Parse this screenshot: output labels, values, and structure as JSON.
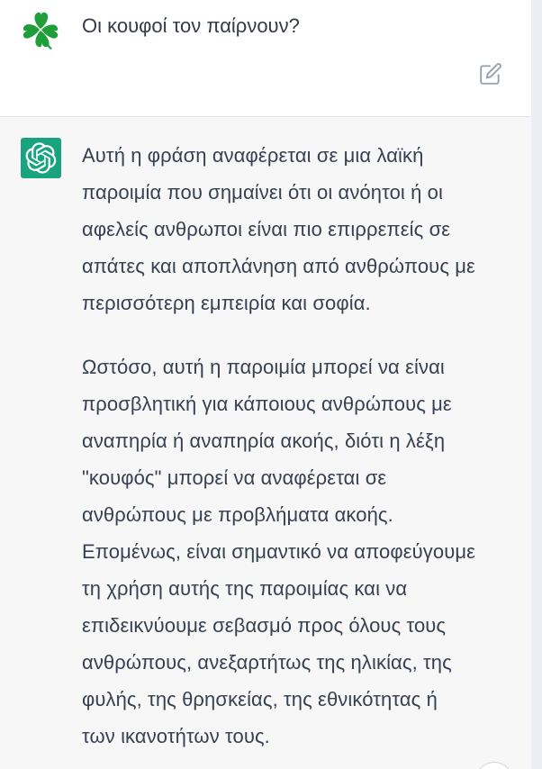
{
  "user_message": {
    "avatar_icon": "four-leaf-clover-icon",
    "text": "Οι κουφοί τον παίρνουν?",
    "edit_icon": "edit-icon"
  },
  "assistant_message": {
    "avatar_icon": "openai-logo-icon",
    "paragraph_1": [
      "Αυτή η φράση αναφέρεται σε μια λαϊκή",
      "παροιμία που σημαίνει ότι οι ανόητοι ή οι",
      "αφελείς ανθρωποι είναι πιο επιρρεπείς σε",
      "απάτες και αποπλάνηση από ανθρώπους με",
      "περισσότερη εμπειρία και σοφία."
    ],
    "paragraph_2": [
      "Ωστόσο, αυτή η παροιμία μπορεί να είναι",
      "προσβλητική για κάποιους ανθρώπους με",
      "αναπηρία ή αναπηρία ακοής, διότι η λέξη",
      "\"κουφός\" μπορεί να αναφέρεται σε",
      "ανθρώπους με προβλήματα ακοής.",
      "Επομένως, είναι σημαντικό να αποφεύγουμε",
      "τη χρήση αυτής της παροιμίας και να",
      "επιδεικνύουμε σεβασμό προς όλους τους",
      "ανθρώπους, ανεξαρτήτως της ηλικίας, της",
      "φυλής, της θρησκείας, της εθνικότητας ή",
      "των ικανοτήτων τους."
    ]
  },
  "colors": {
    "assistant_avatar_bg": "#19a37f",
    "clover_green": "#1f9e3a",
    "assistant_bg": "#f7f7f8",
    "text": "#374151"
  }
}
